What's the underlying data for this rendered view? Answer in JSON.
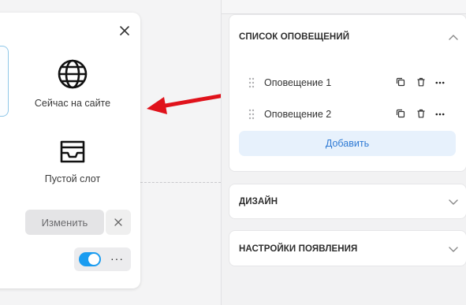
{
  "card": {
    "slot1_label": "Сейчас на сайте",
    "slot2_label": "Пустой слот",
    "edit_label": "Изменить",
    "more_label": "···",
    "toggle_on": true
  },
  "panel": {
    "notifications": {
      "title": "СПИСОК ОПОВЕЩЕНИЙ",
      "expanded": true,
      "items": [
        {
          "label": "Оповещение 1"
        },
        {
          "label": "Оповещение 2"
        }
      ],
      "add_label": "Добавить"
    },
    "design": {
      "title": "ДИЗАЙН",
      "expanded": false
    },
    "appearance": {
      "title": "НАСТРОЙКИ ПОЯВЛЕНИЯ",
      "expanded": false
    }
  },
  "colors": {
    "accent": "#1a9cf0",
    "arrow": "#e0121b",
    "add_button_bg": "#e7f1fc",
    "add_button_text": "#2f7ad4"
  },
  "icons": [
    "close-icon",
    "globe-icon",
    "inbox-icon",
    "drag-handle-icon",
    "copy-icon",
    "trash-icon",
    "more-icon",
    "chevron-up-icon",
    "chevron-down-icon"
  ]
}
